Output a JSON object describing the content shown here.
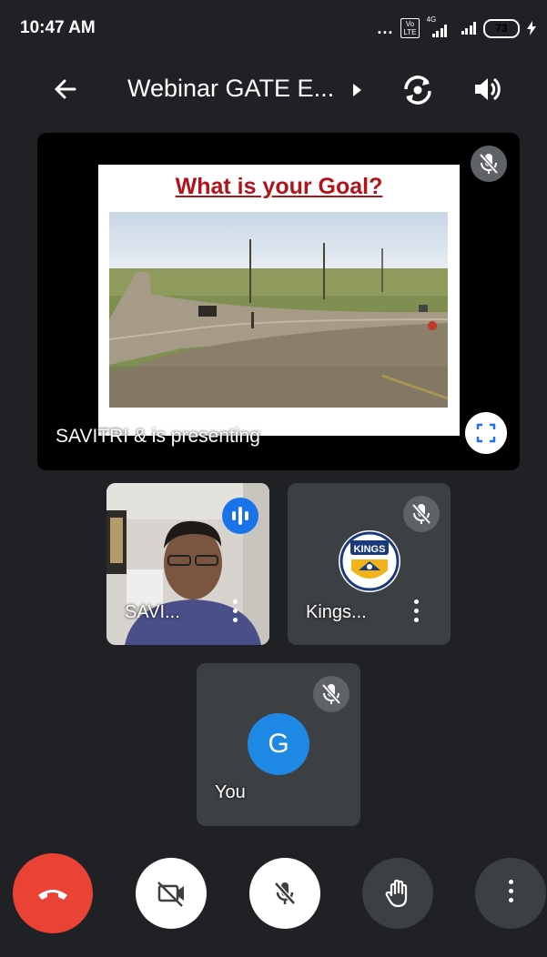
{
  "status_bar": {
    "time": "10:47 AM",
    "dots": "...",
    "volte": "Vo LTE",
    "network": "4G",
    "battery": "73"
  },
  "header": {
    "title": "Webinar GATE E...",
    "icons": [
      "back-arrow-icon",
      "chevron-right-icon",
      "camera-switch-icon",
      "speaker-icon"
    ]
  },
  "presentation": {
    "slide_title": "What is your Goal?",
    "caption": "SAVITRI & is presenting",
    "icons": [
      "mic-off-icon",
      "fullscreen-icon"
    ]
  },
  "participants": [
    {
      "name": "SAVI...",
      "state": "speaking",
      "icon": "audio-level-icon"
    },
    {
      "name": "Kings...",
      "state": "muted",
      "icon": "mic-off-icon",
      "avatar": "KINGS"
    },
    {
      "name": "You",
      "state": "muted",
      "icon": "mic-off-icon",
      "avatar_letter": "G"
    }
  ],
  "controls": [
    {
      "name": "end-call",
      "icon": "phone-hangup-icon",
      "color": "#ea4335"
    },
    {
      "name": "camera-toggle",
      "icon": "video-off-icon"
    },
    {
      "name": "mic-toggle",
      "icon": "mic-off-icon"
    },
    {
      "name": "raise-hand",
      "icon": "hand-icon"
    },
    {
      "name": "more-options",
      "icon": "more-vert-icon"
    }
  ],
  "colors": {
    "background": "#202124",
    "tile": "#3c4043",
    "accent": "#1a73e8",
    "end_call": "#ea4335",
    "slide_title": "#b3121a"
  }
}
